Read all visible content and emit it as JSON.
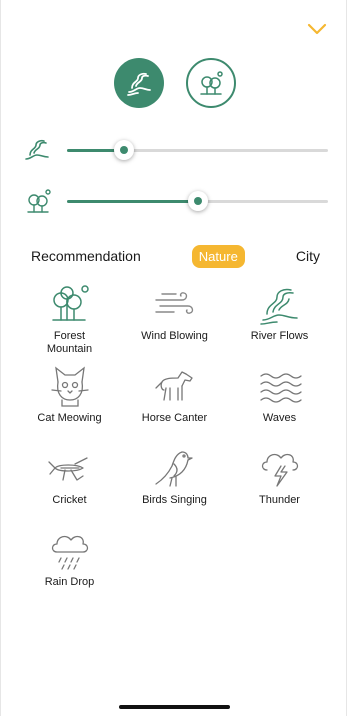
{
  "header": {
    "collapse_icon": "chevron-down-icon",
    "accent": "#f5b731"
  },
  "mode_buttons": [
    {
      "name": "river",
      "icon": "river-icon",
      "active": true
    },
    {
      "name": "forest",
      "icon": "forest-icon",
      "active": false
    }
  ],
  "sliders": [
    {
      "name": "river-volume",
      "icon": "river-icon",
      "value": 0.22
    },
    {
      "name": "forest-volume",
      "icon": "forest-icon",
      "value": 0.5
    }
  ],
  "tabs": {
    "recommendation": "Recommendation",
    "nature": "Nature",
    "city": "City",
    "selected": "Nature"
  },
  "sounds": [
    {
      "label": "Forest\nMountain",
      "icon": "forest-icon"
    },
    {
      "label": "Wind Blowing",
      "icon": "wind-icon"
    },
    {
      "label": "River Flows",
      "icon": "river-icon"
    },
    {
      "label": "Cat Meowing",
      "icon": "cat-icon"
    },
    {
      "label": "Horse Canter",
      "icon": "horse-icon"
    },
    {
      "label": "Waves",
      "icon": "waves-icon"
    },
    {
      "label": "Cricket",
      "icon": "cricket-icon"
    },
    {
      "label": "Birds Singing",
      "icon": "bird-icon"
    },
    {
      "label": "Thunder",
      "icon": "thunder-icon"
    },
    {
      "label": "Rain Drop",
      "icon": "rain-icon"
    }
  ],
  "colors": {
    "primary": "#3d8a6e",
    "accent": "#f5b731",
    "track": "#d9d9d9"
  }
}
